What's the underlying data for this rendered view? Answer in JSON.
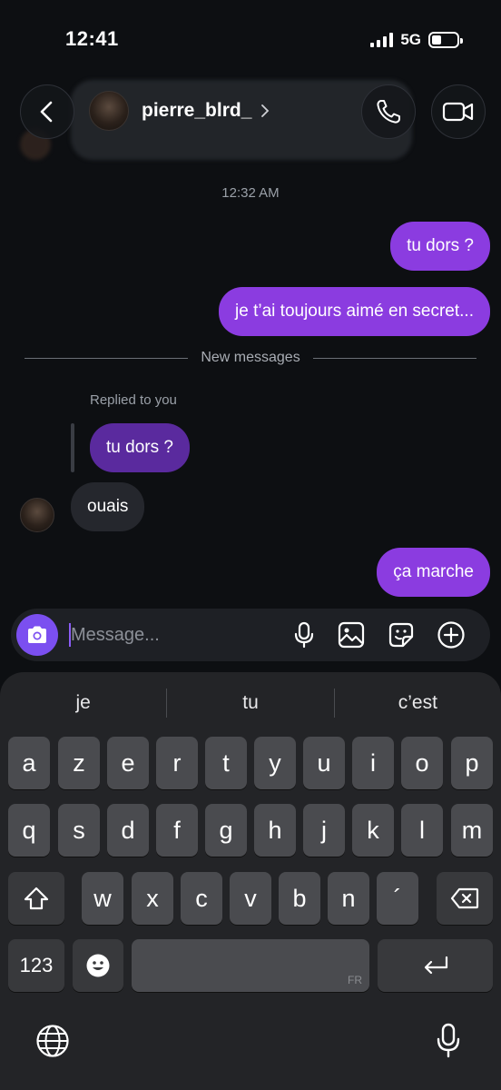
{
  "status_bar": {
    "time": "12:41",
    "network": "5G"
  },
  "header": {
    "username": "pierre_blrd_"
  },
  "conversation": {
    "timestamp": "12:32 AM",
    "outgoing_1": "tu dors ?",
    "outgoing_2": "je t’ai toujours aimé en secret...",
    "divider": "New messages",
    "replied_label": "Replied to you",
    "reply_quote": "tu dors ?",
    "incoming": "ouais",
    "outgoing_3": "ça marche"
  },
  "composer": {
    "placeholder": "Message..."
  },
  "keyboard": {
    "suggestions": [
      "je",
      "tu",
      "c’est"
    ],
    "row1": [
      "a",
      "z",
      "e",
      "r",
      "t",
      "y",
      "u",
      "i",
      "o",
      "p"
    ],
    "row2": [
      "q",
      "s",
      "d",
      "f",
      "g",
      "h",
      "j",
      "k",
      "l",
      "m"
    ],
    "row3": [
      "w",
      "x",
      "c",
      "v",
      "b",
      "n",
      "´"
    ],
    "numbers_key": "123",
    "language_label": "FR"
  },
  "colors": {
    "accent": "#8b3ce0",
    "camera": "#7b4ff0",
    "incoming": "#25272d",
    "background": "#0d0f12"
  },
  "icons": [
    "back-chevron-icon",
    "phone-icon",
    "video-camera-icon",
    "camera-icon",
    "microphone-icon",
    "image-icon",
    "sticker-icon",
    "plus-circle-icon",
    "shift-icon",
    "backspace-icon",
    "emoji-icon",
    "return-icon",
    "globe-icon"
  ]
}
